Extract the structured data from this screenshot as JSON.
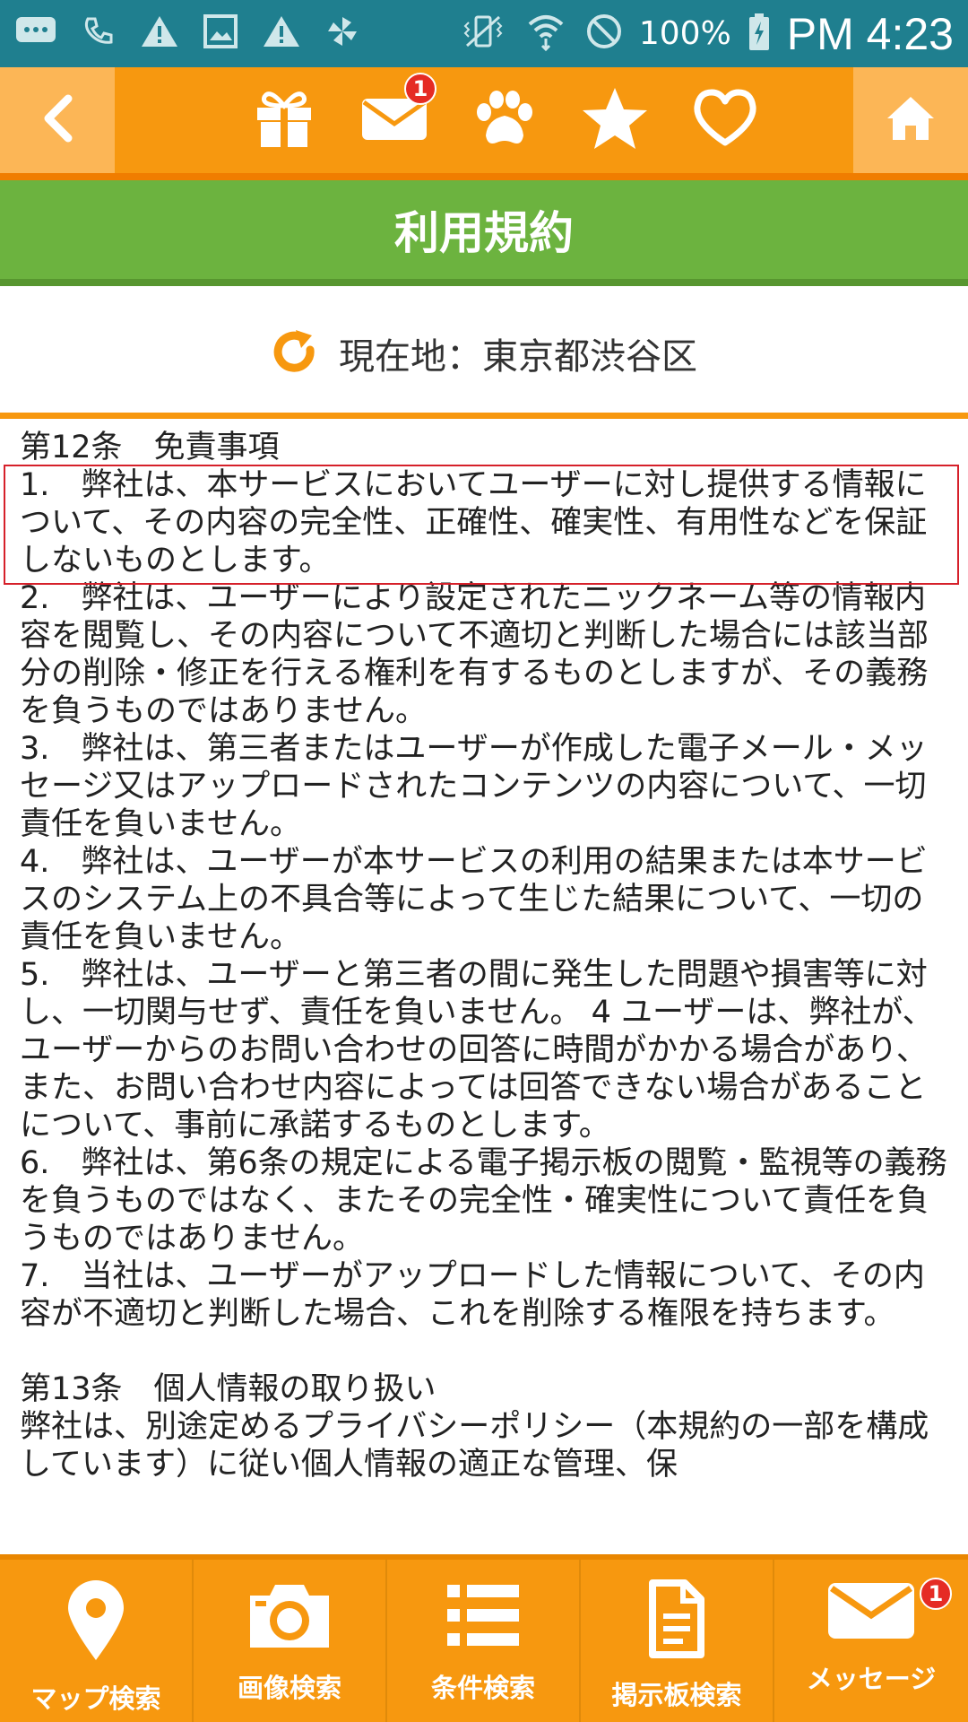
{
  "status_bar": {
    "left_icons": [
      "message-icon",
      "phone-icon",
      "warning-icon",
      "image-icon",
      "warning-icon",
      "pinwheel-icon"
    ],
    "right_icons": [
      "vibrate-icon",
      "wifi-icon",
      "no-sign-icon"
    ],
    "battery": "100%",
    "time": "PM 4:23"
  },
  "top_nav": {
    "mail_badge": "1"
  },
  "title": "利用規約",
  "location": {
    "label": "現在地：東京都渋谷区"
  },
  "content": {
    "heading_12": "第12条　免責事項",
    "items_12": [
      "1.　弊社は、本サービスにおいてユーザーに対し提供する情報について、その内容の完全性、正確性、確実性、有用性などを保証しないものとします。",
      "2.　弊社は、ユーザーにより設定されたニックネーム等の情報内容を閲覧し、その内容について不適切と判断した場合には該当部分の削除・修正を行える権利を有するものとしますが、その義務を負うものではありません。",
      "3.　弊社は、第三者またはユーザーが作成した電子メール・メッセージ又はアップロードされたコンテンツの内容について、一切責任を負いません。",
      "4.　弊社は、ユーザーが本サービスの利用の結果または本サービスのシステム上の不具合等によって生じた結果について、一切の責任を負いません。",
      "5.　弊社は、ユーザーと第三者の間に発生した問題や損害等に対し、一切関与せず、責任を負いません。 4 ユーザーは、弊社が、ユーザーからのお問い合わせの回答に時間がかかる場合があり、また、お問い合わせ内容によっては回答できない場合があることについて、事前に承諾するものとします。",
      "6.　弊社は、第6条の規定による電子掲示板の閲覧・監視等の義務を負うものではなく、またその完全性・確実性について責任を負うものではありません。",
      "7.　当社は、ユーザーがアップロードした情報について、その内容が不適切と判断した場合、これを削除する権限を持ちます。"
    ],
    "heading_13": "第13条　個人情報の取り扱い",
    "text_13": "弊社は、別途定めるプライバシーポリシー（本規約の一部を構成しています）に従い個人情報の適正な管理、保"
  },
  "bottom_tabs": [
    {
      "label": "マップ検索",
      "icon": "map-pin-icon"
    },
    {
      "label": "画像検索",
      "icon": "camera-icon"
    },
    {
      "label": "条件検索",
      "icon": "list-icon"
    },
    {
      "label": "掲示板検索",
      "icon": "document-icon"
    },
    {
      "label": "メッセージ",
      "icon": "mail-icon",
      "badge": "1"
    }
  ],
  "colors": {
    "status_bar": "#1f7f8f",
    "nav_orange": "#f7980f",
    "nav_light_orange": "#fcb656",
    "title_green": "#6cb33f",
    "badge_red": "#e52b24",
    "highlight_red": "#d6202a"
  }
}
